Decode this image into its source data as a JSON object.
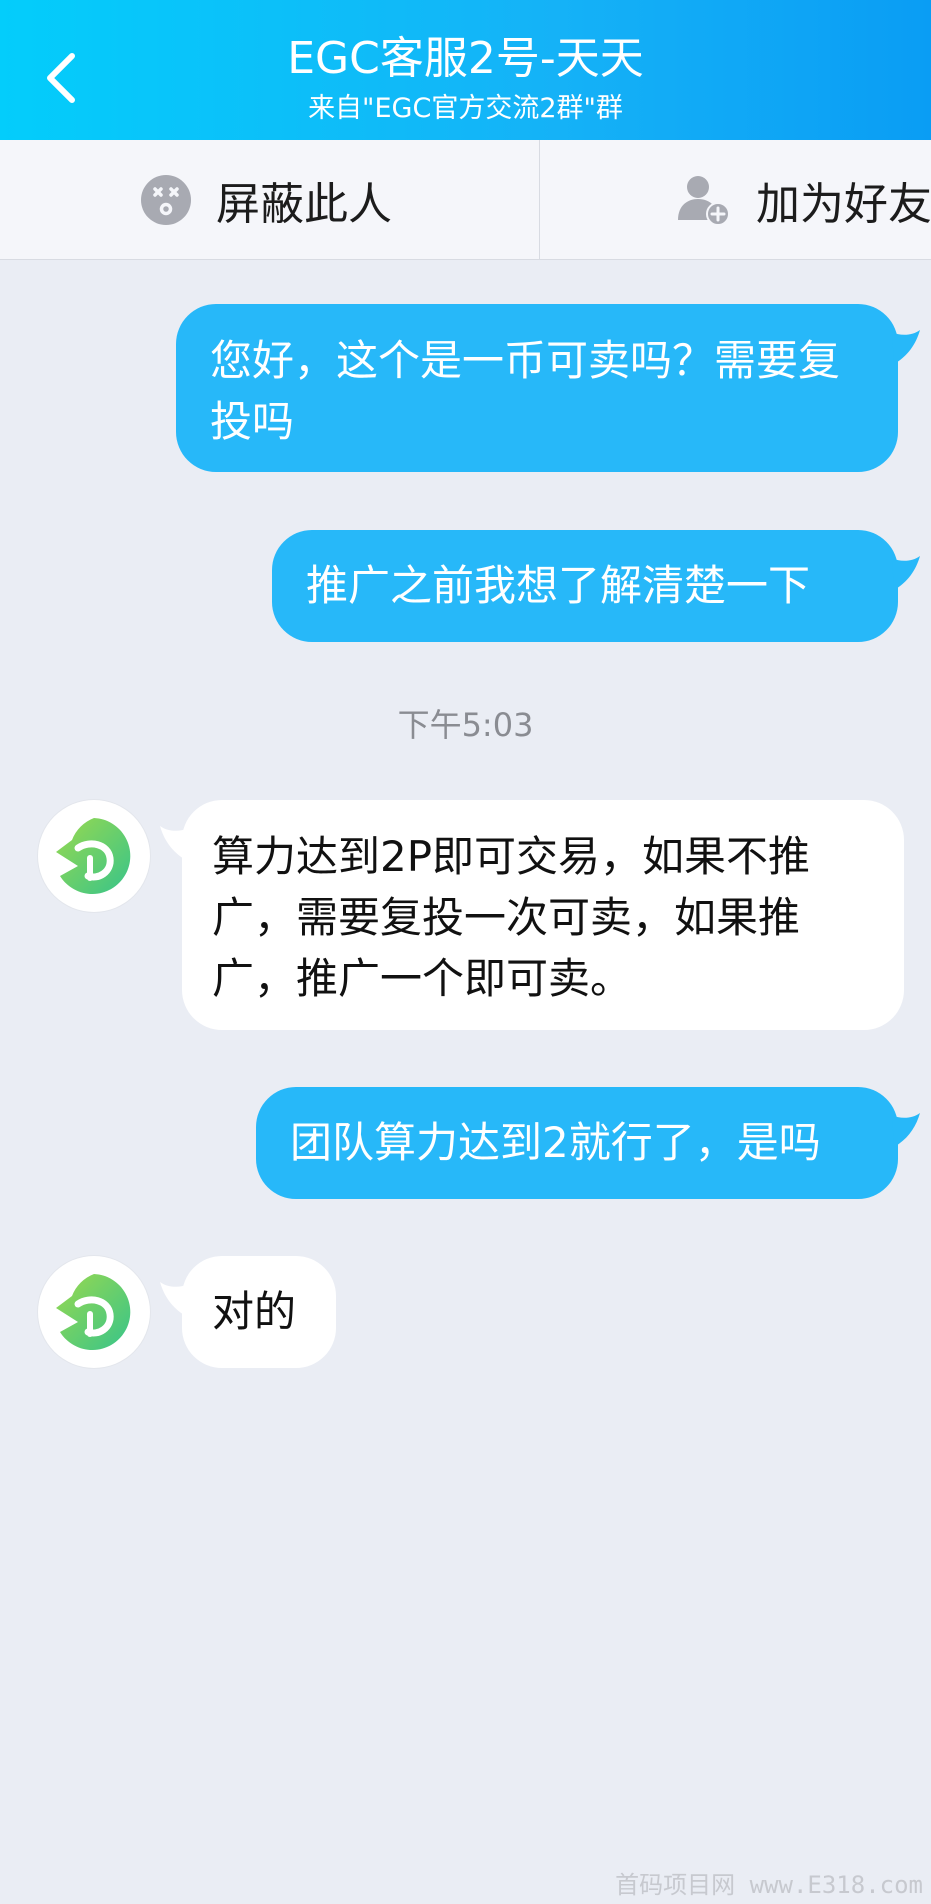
{
  "header": {
    "title": "EGC客服2号-天天",
    "subtitle": "来自\"EGC官方交流2群\"群"
  },
  "actions": {
    "block_label": "屏蔽此人",
    "add_friend_label": "加为好友"
  },
  "messages": [
    {
      "side": "out",
      "text": "您好，这个是一币可卖吗？需要复投吗"
    },
    {
      "side": "out",
      "text": "推广之前我想了解清楚一下"
    },
    {
      "side": "in",
      "text": "算力达到2P即可交易，如果不推广，需要复投一次可卖，如果推广，推广一个即可卖。"
    },
    {
      "side": "out",
      "text": "团队算力达到2就行了，是吗"
    },
    {
      "side": "in",
      "text": "对的"
    }
  ],
  "timestamp": "下午5:03",
  "watermark": "首码项目网 www.E318.com",
  "colors": {
    "header_start": "#03cdfb",
    "header_end": "#0a9df4",
    "outgoing_bubble": "#27b8f9",
    "incoming_bubble": "#ffffff",
    "chat_background": "#eaedf4"
  }
}
